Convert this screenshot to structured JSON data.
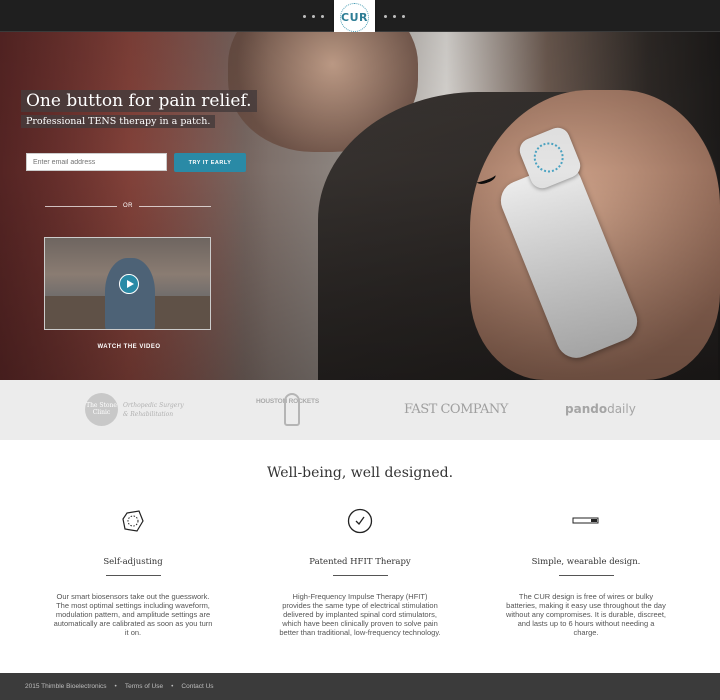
{
  "nav": {
    "logo": "CUR"
  },
  "hero": {
    "headline": "One button for pain relief.",
    "subhead": "Professional TENS therapy in a patch.",
    "email_placeholder": "Enter email address",
    "try_label": "TRY IT EARLY",
    "or_label": "OR",
    "watch_label": "WATCH THE VIDEO"
  },
  "press": {
    "stone_name": "The Stone Clinic",
    "stone_sub_1": "Orthopedic Surgery",
    "stone_sub_2": "& Rehabilitation",
    "rockets": "HOUSTON ROCKETS",
    "fastco": "FAST COMPANY",
    "pando_a": "pando",
    "pando_b": "daily"
  },
  "features": {
    "title": "Well-being, well designed.",
    "items": [
      {
        "title": "Self-adjusting",
        "desc": "Our smart biosensors take out the guesswork. The most optimal settings including waveform, modulation pattern, and amplitude settings are automatically are calibrated as soon as you turn it on."
      },
      {
        "title": "Patented HFIT Therapy",
        "desc": "High-Frequency Impulse Therapy (HFIT) provides the same type of electrical stimulation delivered by implanted spinal cord stimulators, which have been clinically proven to solve pain better than traditional, low-frequency technology."
      },
      {
        "title": "Simple, wearable design.",
        "desc": "The CUR design is free of wires or bulky batteries, making it easy use throughout the day without any compromises. It is durable, discreet, and lasts up to 6 hours without needing a charge."
      }
    ]
  },
  "footer": {
    "copyright": "2015 Thimble Bioelectronics",
    "sep": "•",
    "terms": "Terms of Use",
    "contact": "Contact Us"
  },
  "colors": {
    "accent": "#2a8aa6",
    "nav_bg": "#1f1f1f",
    "footer_bg": "#3b3b3b"
  }
}
